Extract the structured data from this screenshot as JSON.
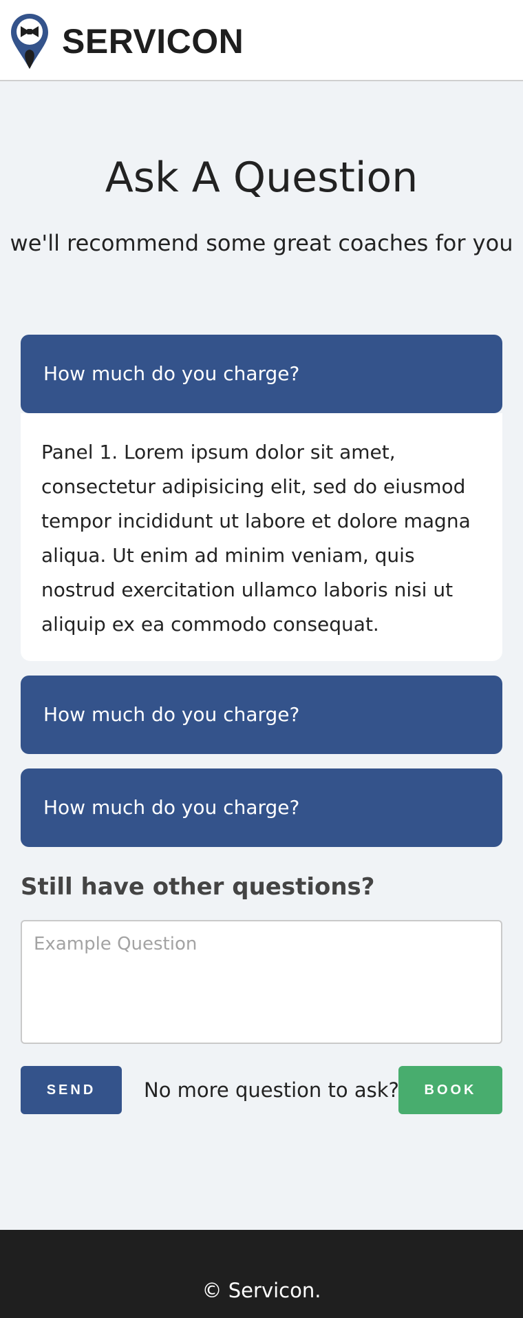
{
  "header": {
    "brand": "SERVICON",
    "logo_icon": "location-pin-bowtie-icon",
    "brand_color": "#34538b"
  },
  "hero": {
    "title": "Ask A Question",
    "subtitle": "we'll recommend some great coaches for you"
  },
  "faq": {
    "items": [
      {
        "question": "How much do you charge?",
        "expanded": true,
        "answer": "Panel 1. Lorem ipsum dolor sit amet, consectetur adipisicing elit, sed do eiusmod tempor incididunt ut labore et dolore magna aliqua. Ut enim ad minim veniam, quis nostrud exercitation ullamco laboris nisi ut aliquip ex ea commodo consequat."
      },
      {
        "question": "How much do you charge?",
        "expanded": false
      },
      {
        "question": "How much do you charge?",
        "expanded": false
      }
    ]
  },
  "ask": {
    "heading": "Still have other questions?",
    "input_value": "",
    "input_placeholder": "Example Question",
    "send_label": "SEND",
    "no_more_text": "No more question to ask?",
    "book_label": "BOOK"
  },
  "footer": {
    "copyright": "© Servicon."
  },
  "colors": {
    "accordion": "#34538b",
    "send": "#34538b",
    "book": "#48ad6e",
    "footer": "#1f1f1f",
    "page_bg": "#f0f3f6"
  }
}
